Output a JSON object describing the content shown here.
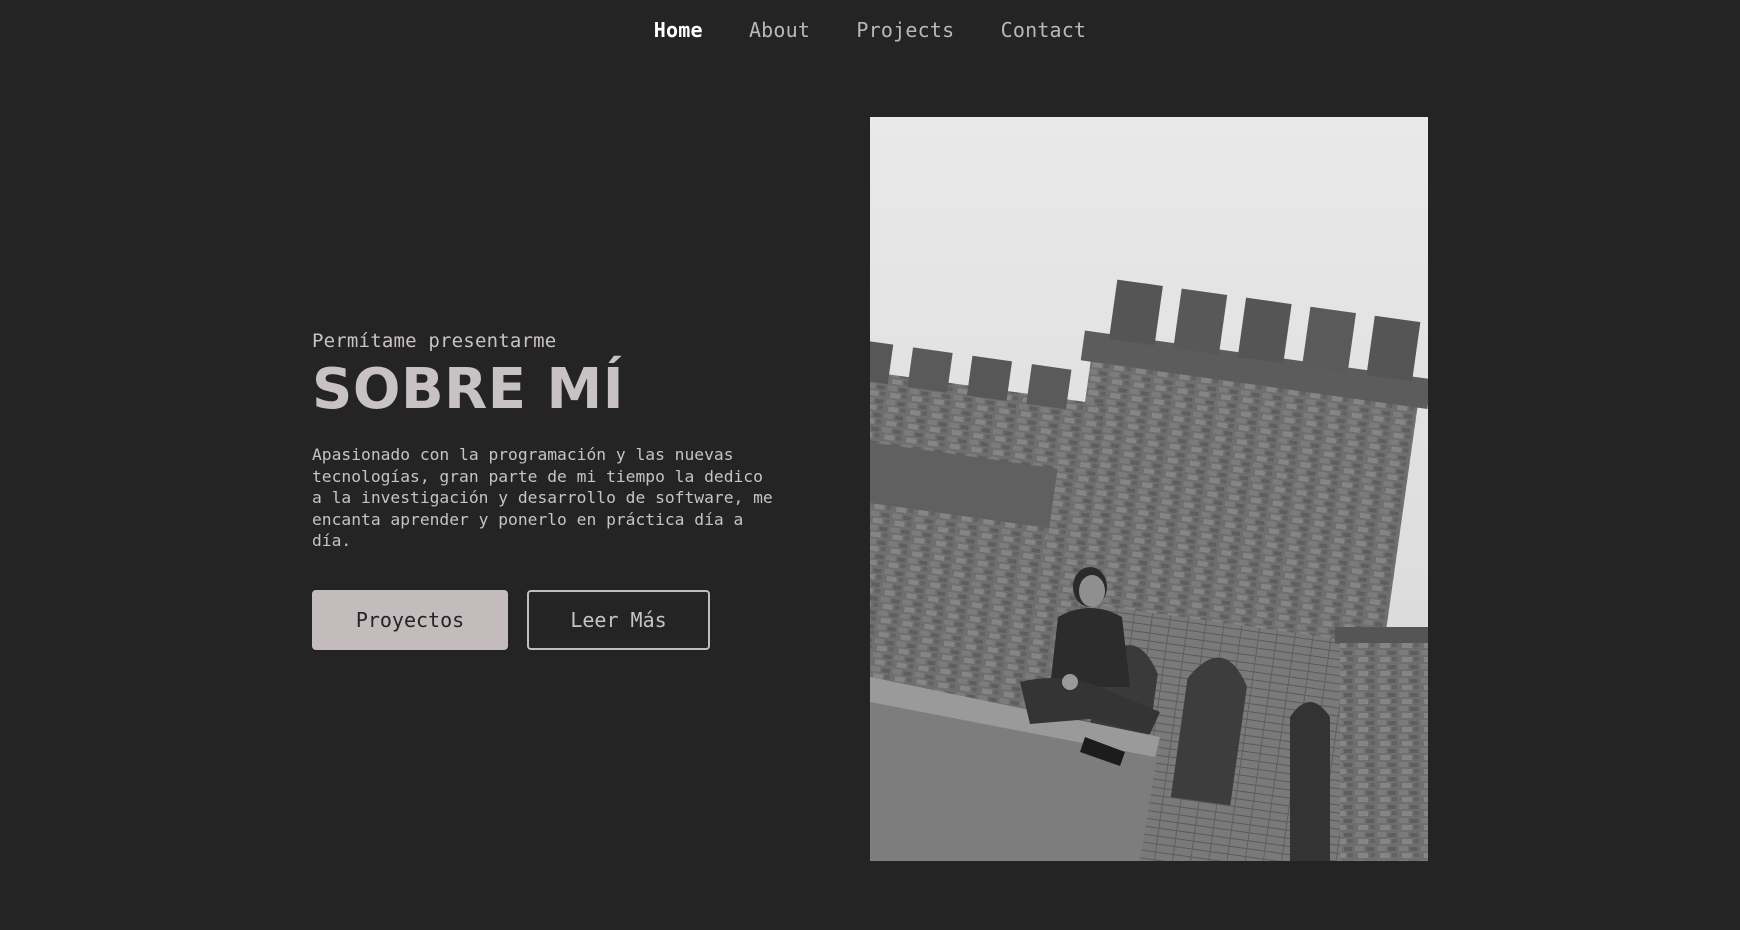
{
  "nav": {
    "items": [
      "Home",
      "About",
      "Projects",
      "Contact"
    ],
    "active": "Home"
  },
  "hero": {
    "kicker": "Permítame presentarme",
    "title": "SOBRE MÍ",
    "description": "Apasionado con la programación y las nuevas tecnologías, gran parte de mi tiempo la dedico a la investigación y desarrollo de software, me encanta aprender y ponerlo en práctica día a día.",
    "primary_button": "Proyectos",
    "secondary_button": "Leer Más"
  },
  "photo": {
    "subject": "black-and-white photo of a person sitting on a castle wall"
  },
  "colors": {
    "background": "#242425",
    "accent": "#c4bbbd",
    "text": "#c9c2c4",
    "nav_active": "#ffffff"
  }
}
